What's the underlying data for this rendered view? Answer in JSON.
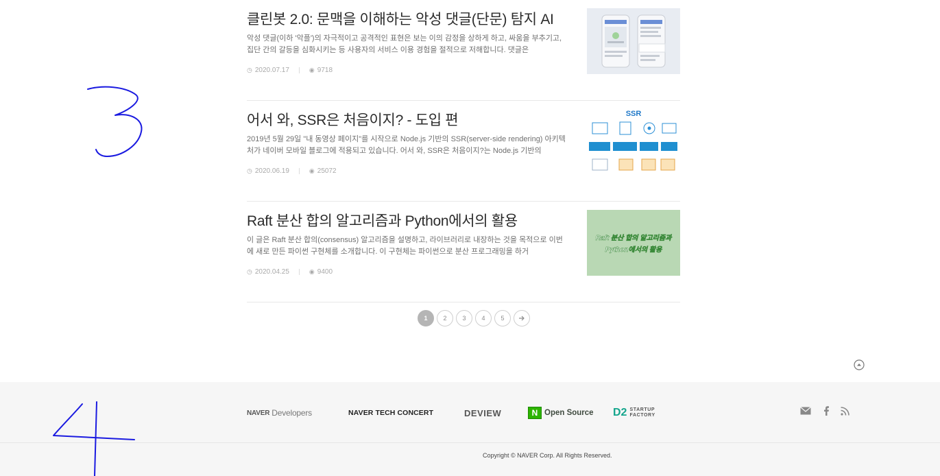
{
  "posts": [
    {
      "title": "클린봇 2.0: 문맥을 이해하는 악성 댓글(단문) 탐지 AI",
      "excerpt": "악성 댓글(이하 '악플')의 자극적이고 공격적인 표현은 보는 이의 감정을 상하게 하고, 싸움을 부추기고, 집단 간의 갈등을 심화시키는 등 사용자의 서비스 이용 경험을 절적으로 저해합니다. 댓글은",
      "date": "2020.07.17",
      "views": "9718"
    },
    {
      "title": "어서 와, SSR은 처음이지? - 도입 편",
      "excerpt": "2019년 5월 29일 \"내 동영상 페이지\"를 시작으로 Node.js 기반의 SSR(server-side rendering) 아키텍처가 네이버 모바일 블로그에 적용되고 있습니다. 어서 와, SSR은 처음이지?는 Node.js 기반의",
      "date": "2020.06.19",
      "views": "25072",
      "thumb_label": "SSR"
    },
    {
      "title": "Raft 분산 합의 알고리즘과 Python에서의 활용",
      "excerpt": "이 글은 Raft 분산 합의(consensus) 알고리즘을 설명하고, 라이브러리로 내장하는 것을 목적으로 이번에 새로 만든 파이썬 구현체를 소개합니다. 이 구현체는 파이썬으로 분산 프로그래밍을 하거",
      "date": "2020.04.25",
      "views": "9400",
      "thumb_line1": "Raft 분산 합의 알고리즘과",
      "thumb_line2": "Python에서의 활용"
    }
  ],
  "pagination": {
    "pages": [
      "1",
      "2",
      "3",
      "4",
      "5"
    ],
    "current": "1",
    "next_icon": "arrow-right-icon"
  },
  "footer": {
    "naver_dev_bold": "NAVER",
    "naver_dev_light": "Developers",
    "tech_concert": "NAVER TECH CONCERT",
    "deview": "DEVIEW",
    "opensource_badge": "N",
    "opensource": "Open Source",
    "d2": "D2",
    "startup_line1": "STARTUP",
    "startup_line2": "FACTORY",
    "copyright": "Copyright © NAVER Corp. All Rights Reserved."
  },
  "annotations": {
    "handwritten_3": "3",
    "handwritten_4": "4"
  },
  "colors": {
    "accent_green": "#2db400",
    "d2_teal": "#14a58c",
    "ink_blue": "#1a1ae0",
    "thumb_green": "#b9d8b4"
  }
}
